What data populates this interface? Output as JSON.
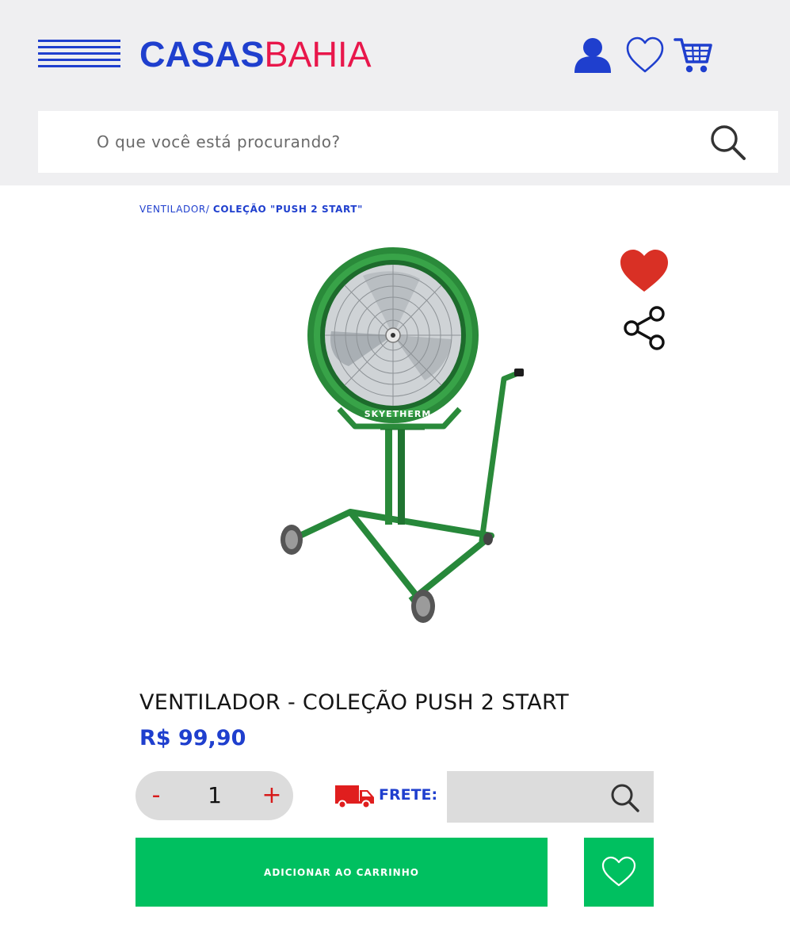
{
  "header": {
    "logo_primary": "CASAS",
    "logo_secondary": "BAHIA",
    "brand_blue": "#1f3fce",
    "brand_red": "#e8174b",
    "icons": [
      "menu-icon",
      "user-icon",
      "heart-outline-icon",
      "cart-icon"
    ]
  },
  "search": {
    "placeholder": "O que você está procurando?",
    "value": "",
    "icon": "search-icon"
  },
  "breadcrumb": {
    "category": "VENTILADOR/",
    "current": "COLEÇÃO \"PUSH 2 START\""
  },
  "product": {
    "image_alt": "Ventilador industrial verde com pedestal e rodas",
    "image_brand_text": "SKYETHERM",
    "title": "VENTILADOR - COLEÇÃO PUSH 2 START",
    "price": "R$ 99,90",
    "favorite_color": "#d93025",
    "actions": [
      "favorite-heart-icon",
      "share-icon"
    ]
  },
  "quantity": {
    "minus_label": "-",
    "value": "1",
    "plus_label": "+"
  },
  "shipping": {
    "label": "FRETE:",
    "input_value": "",
    "icon": "truck-icon",
    "search_icon": "search-icon"
  },
  "cart": {
    "add_label": "ADICIONAR AO CARRINHO",
    "accent": "#00c060",
    "wishlist_icon": "heart-outline-icon"
  }
}
